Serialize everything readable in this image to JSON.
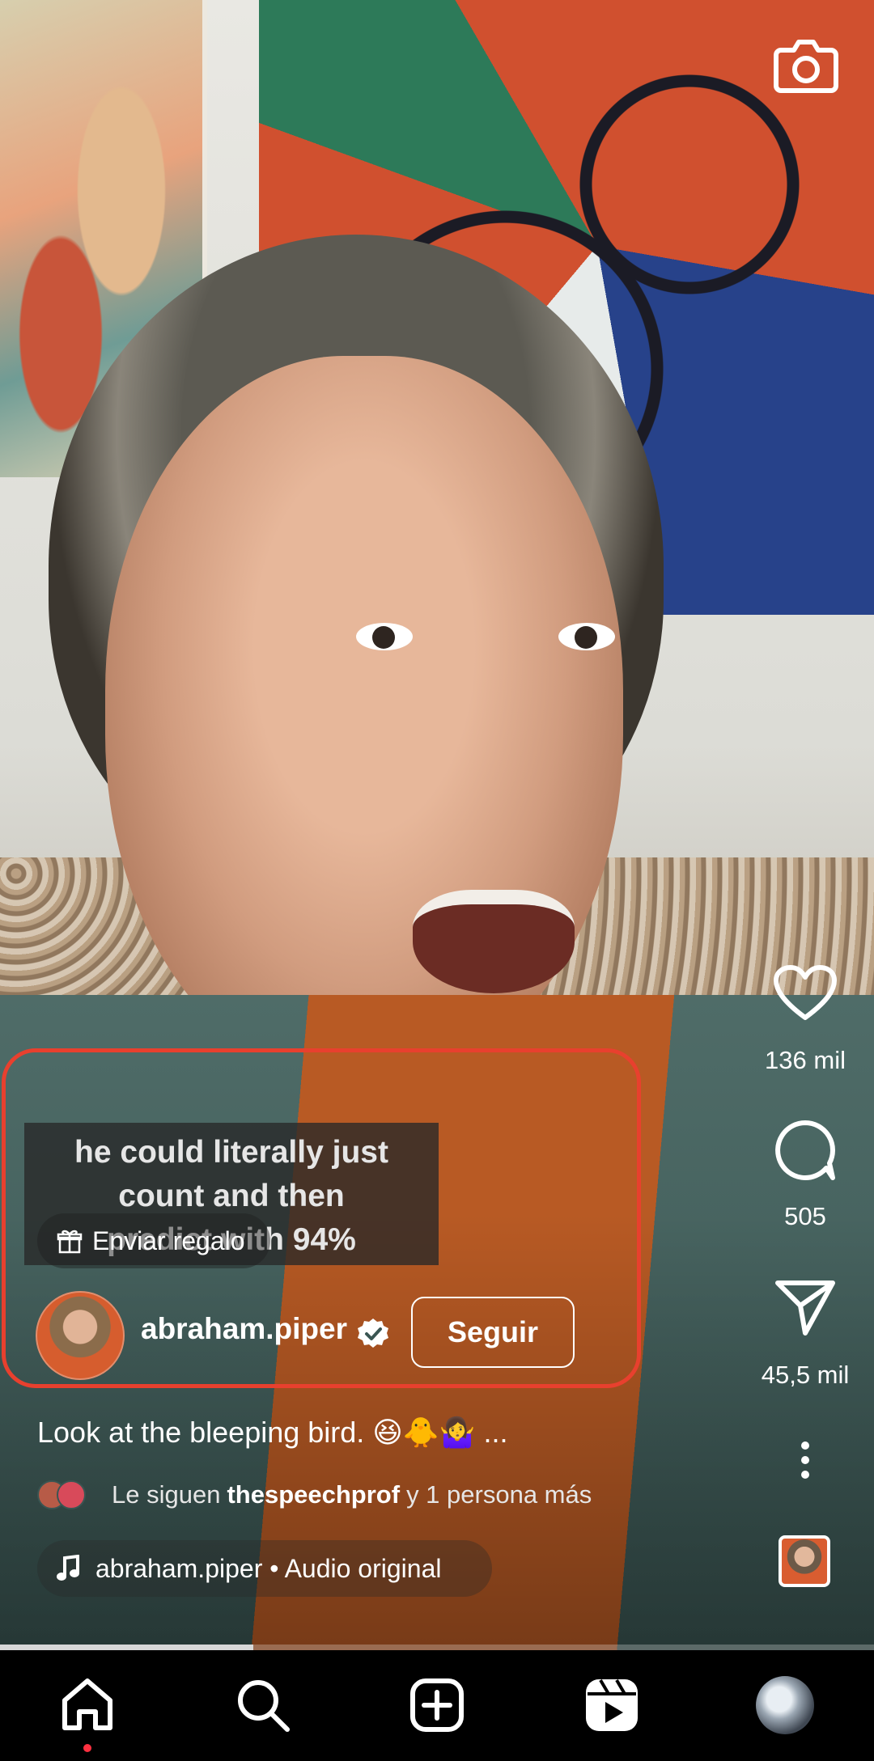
{
  "header": {
    "camera_icon": "camera-icon"
  },
  "caption": {
    "lines": [
      "he could literally just",
      "count and then",
      "predict with 94%"
    ]
  },
  "gift": {
    "label": "Enviar regalo",
    "icon": "gift-icon"
  },
  "author": {
    "username": "abraham.piper",
    "verified": true,
    "follow_label": "Seguir"
  },
  "post": {
    "description": "Look at the bleeping bird. 😆🐥🤷‍♀️ ...",
    "followed_by_prefix": "Le siguen",
    "followed_by_user": "thespeechprof",
    "followed_by_suffix": "y 1 persona más"
  },
  "audio": {
    "label": "abraham.piper • Audio original",
    "icon": "music-note-icon"
  },
  "actions": {
    "likes": "136 mil",
    "comments": "505",
    "shares": "45,5 mil"
  },
  "progress": {
    "fraction": 0.29
  },
  "colors": {
    "highlight": "#e8402e",
    "notification_dot": "#ff3040",
    "nav_bg": "#000000"
  },
  "nav": {
    "items": [
      "home-icon",
      "search-icon",
      "create-icon",
      "reels-icon",
      "profile-avatar"
    ],
    "active": "home-icon"
  }
}
